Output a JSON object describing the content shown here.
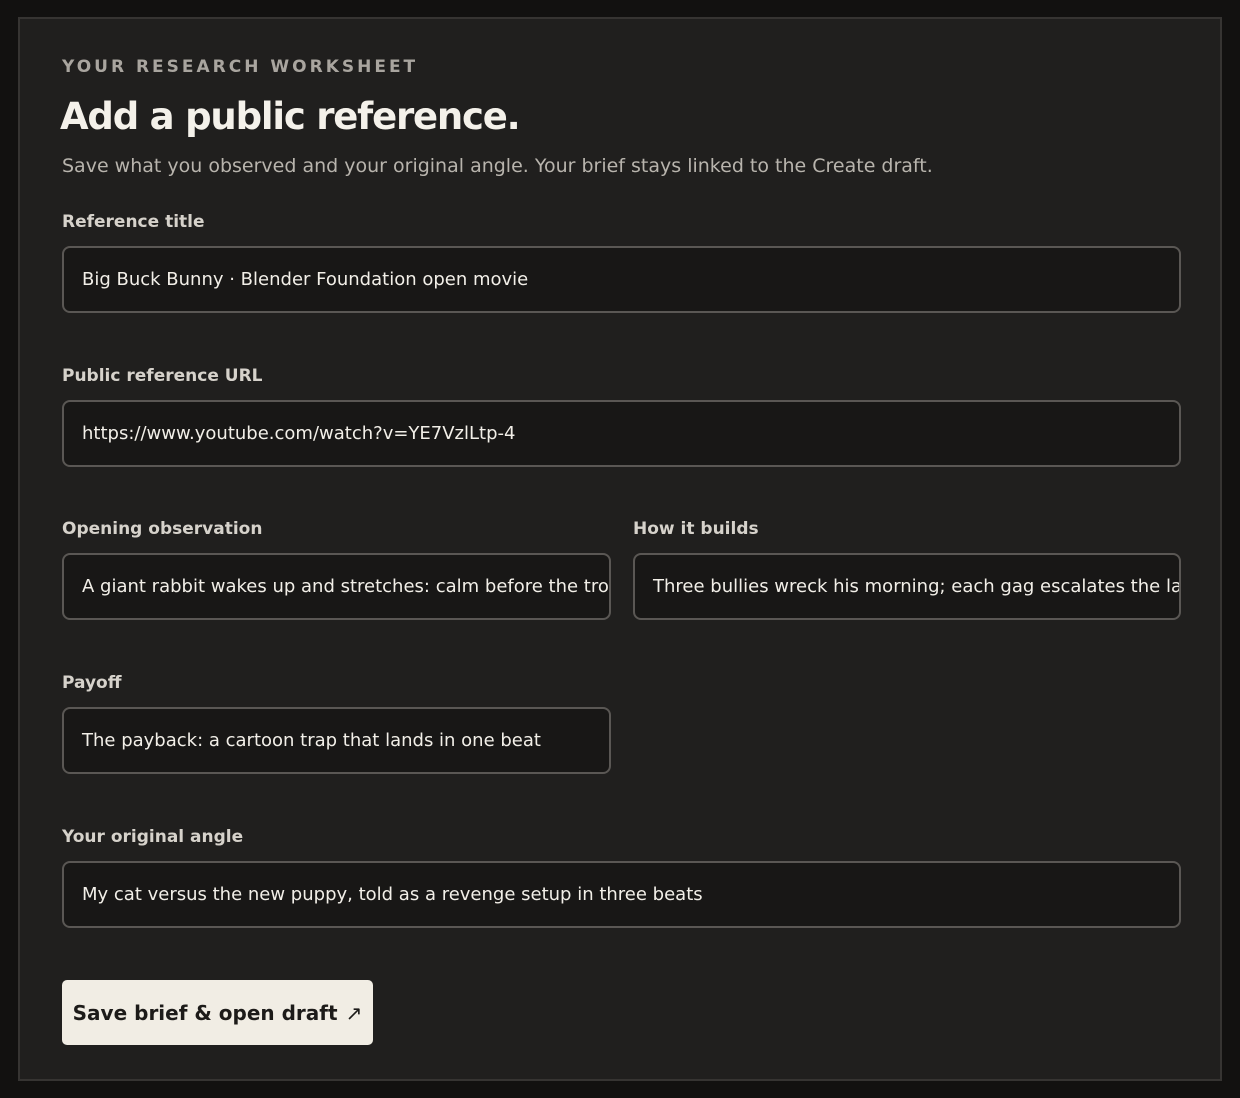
{
  "worksheet": {
    "eyebrow": "YOUR RESEARCH WORKSHEET",
    "title": "Add a public reference.",
    "subtitle": "Save what you observed and your original angle. Your brief stays linked to the Create draft."
  },
  "fields": {
    "reference_title": {
      "label": "Reference title",
      "value": "Big Buck Bunny · Blender Foundation open movie"
    },
    "reference_url": {
      "label": "Public reference URL",
      "value": "https://www.youtube.com/watch?v=YE7VzlLtp-4"
    },
    "opening_observation": {
      "label": "Opening observation",
      "value": "A giant rabbit wakes up and stretches: calm before the troub"
    },
    "how_it_builds": {
      "label": "How it builds",
      "value": "Three bullies wreck his morning; each gag escalates the last"
    },
    "payoff": {
      "label": "Payoff",
      "value": "The payback: a cartoon trap that lands in one beat"
    },
    "original_angle": {
      "label": "Your original angle",
      "value": "My cat versus the new puppy, told as a revenge setup in three beats"
    }
  },
  "actions": {
    "save_label": "Save brief & open draft",
    "save_icon": "arrow-up-right-icon",
    "save_icon_glyph": "↗"
  },
  "colors": {
    "background": "#121110",
    "panel": "#201f1e",
    "button": "#f1ede4"
  }
}
